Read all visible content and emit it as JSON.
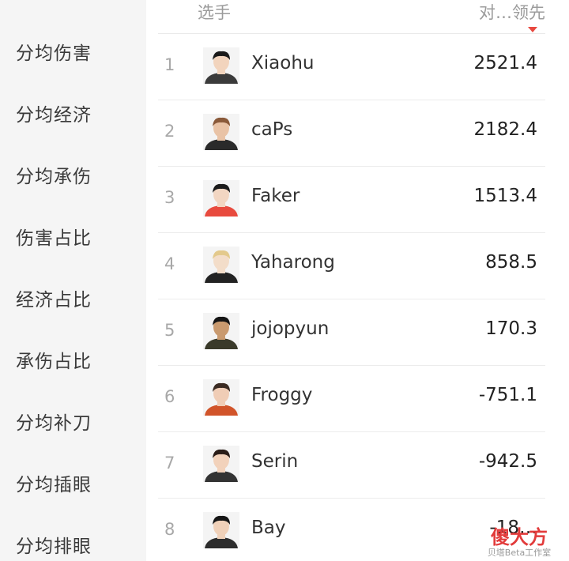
{
  "sidebar": {
    "items": [
      {
        "label": "分均伤害"
      },
      {
        "label": "分均经济"
      },
      {
        "label": "分均承伤"
      },
      {
        "label": "伤害占比"
      },
      {
        "label": "经济占比"
      },
      {
        "label": "承伤占比"
      },
      {
        "label": "分均补刀"
      },
      {
        "label": "分均插眼"
      },
      {
        "label": "分均排眼"
      }
    ]
  },
  "table": {
    "header": {
      "player": "选手",
      "stat": "对…领先"
    },
    "rows": [
      {
        "rank": "1",
        "name": "Xiaohu",
        "value": "2521.4",
        "avatar_jersey": "#3b3b3b",
        "avatar_skin": "#f2d4bd",
        "avatar_hair": "#1a1a1a"
      },
      {
        "rank": "2",
        "name": "caPs",
        "value": "2182.4",
        "avatar_jersey": "#2a2a2a",
        "avatar_skin": "#e9c3a6",
        "avatar_hair": "#8a5a3a"
      },
      {
        "rank": "3",
        "name": "Faker",
        "value": "1513.4",
        "avatar_jersey": "#e84a3e",
        "avatar_skin": "#f2d6c2",
        "avatar_hair": "#1b1b1b"
      },
      {
        "rank": "4",
        "name": "Yaharong",
        "value": "858.5",
        "avatar_jersey": "#222222",
        "avatar_skin": "#f3ddc9",
        "avatar_hair": "#e3c98c"
      },
      {
        "rank": "5",
        "name": "jojopyun",
        "value": "170.3",
        "avatar_jersey": "#3a3a2a",
        "avatar_skin": "#c99a6f",
        "avatar_hair": "#151515"
      },
      {
        "rank": "6",
        "name": "Froggy",
        "value": "-751.1",
        "avatar_jersey": "#d1542a",
        "avatar_skin": "#f0cdb6",
        "avatar_hair": "#3a2a22"
      },
      {
        "rank": "7",
        "name": "Serin",
        "value": "-942.5",
        "avatar_jersey": "#333333",
        "avatar_skin": "#f2d2bb",
        "avatar_hair": "#2a1d18"
      },
      {
        "rank": "8",
        "name": "Bay",
        "value": "-18…",
        "avatar_jersey": "#2d2d2d",
        "avatar_skin": "#f0d1b9",
        "avatar_hair": "#161616"
      }
    ]
  },
  "watermark": {
    "logo": "傻大方",
    "subtitle": "贝塔Beta工作室"
  },
  "colors": {
    "sort_arrow": "#e8483f",
    "sidebar_bg": "#f5f5f5"
  }
}
